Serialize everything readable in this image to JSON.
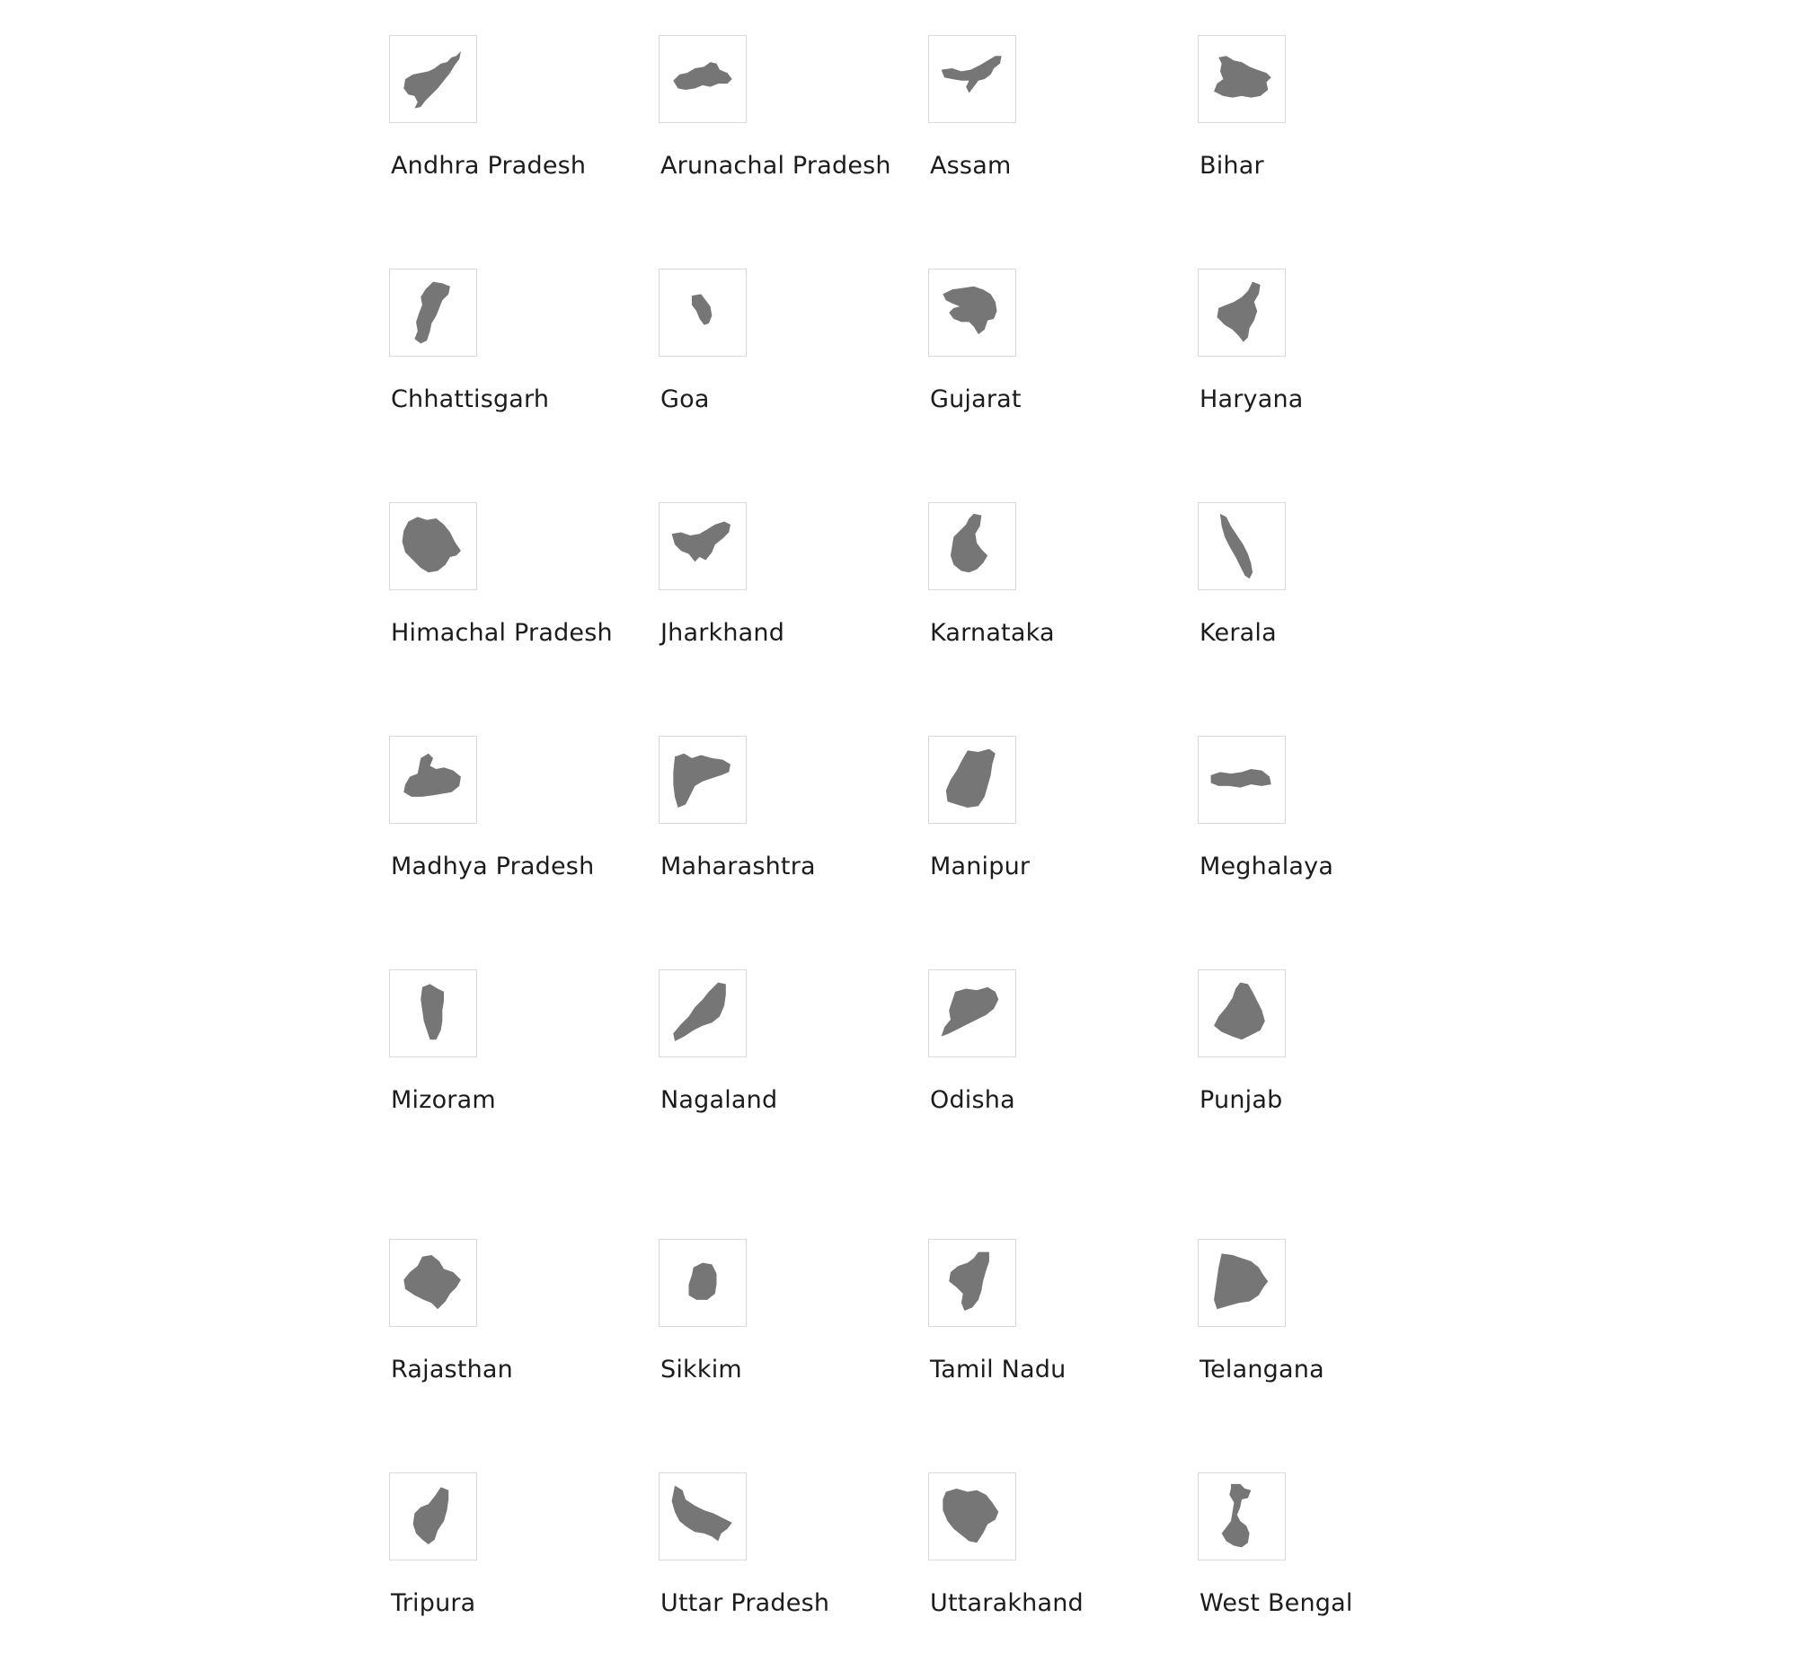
{
  "page": {
    "map_fill_color": "#767676",
    "thumb_border_color": "#d8d8d8",
    "text_color": "#1c1c1c"
  },
  "states": [
    {
      "label": "Andhra Pradesh",
      "icon": "andhra-pradesh-map-icon"
    },
    {
      "label": "Arunachal Pradesh",
      "icon": "arunachal-pradesh-map-icon"
    },
    {
      "label": "Assam",
      "icon": "assam-map-icon"
    },
    {
      "label": "Bihar",
      "icon": "bihar-map-icon"
    },
    {
      "label": "Chhattisgarh",
      "icon": "chhattisgarh-map-icon"
    },
    {
      "label": "Goa",
      "icon": "goa-map-icon"
    },
    {
      "label": "Gujarat",
      "icon": "gujarat-map-icon"
    },
    {
      "label": "Haryana",
      "icon": "haryana-map-icon"
    },
    {
      "label": "Himachal Pradesh",
      "icon": "himachal-pradesh-map-icon"
    },
    {
      "label": "Jharkhand",
      "icon": "jharkhand-map-icon"
    },
    {
      "label": "Karnataka",
      "icon": "karnataka-map-icon"
    },
    {
      "label": "Kerala",
      "icon": "kerala-map-icon"
    },
    {
      "label": "Madhya Pradesh",
      "icon": "madhya-pradesh-map-icon"
    },
    {
      "label": "Maharashtra",
      "icon": "maharashtra-map-icon"
    },
    {
      "label": "Manipur",
      "icon": "manipur-map-icon"
    },
    {
      "label": "Meghalaya",
      "icon": "meghalaya-map-icon"
    },
    {
      "label": "Mizoram",
      "icon": "mizoram-map-icon"
    },
    {
      "label": "Nagaland",
      "icon": "nagaland-map-icon"
    },
    {
      "label": "Odisha",
      "icon": "odisha-map-icon"
    },
    {
      "label": "Punjab",
      "icon": "punjab-map-icon"
    },
    {
      "label": "Rajasthan",
      "icon": "rajasthan-map-icon"
    },
    {
      "label": "Sikkim",
      "icon": "sikkim-map-icon"
    },
    {
      "label": "Tamil Nadu",
      "icon": "tamil-nadu-map-icon"
    },
    {
      "label": "Telangana",
      "icon": "telangana-map-icon"
    },
    {
      "label": "Tripura",
      "icon": "tripura-map-icon"
    },
    {
      "label": "Uttar Pradesh",
      "icon": "uttar-pradesh-map-icon"
    },
    {
      "label": "Uttarakhand",
      "icon": "uttarakhand-map-icon"
    },
    {
      "label": "West Bengal",
      "icon": "west-bengal-map-icon"
    }
  ]
}
